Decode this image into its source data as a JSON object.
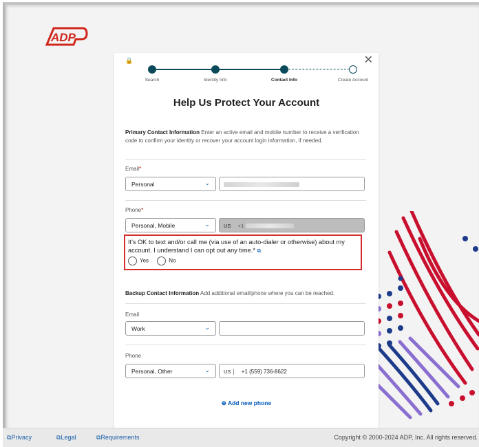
{
  "logo": {
    "text": "ADP"
  },
  "colors": {
    "brand": "#d0271d",
    "step": "#0a4a5a",
    "link": "#0057b8",
    "highlight": "#d52b2b"
  },
  "stepper": [
    {
      "label": "Search",
      "state": "done"
    },
    {
      "label": "Identity Info",
      "state": "done"
    },
    {
      "label": "Contact Info",
      "state": "current"
    },
    {
      "label": "Create Account",
      "state": "pending"
    }
  ],
  "title": "Help Us Protect Your Account",
  "primary": {
    "heading": "Primary Contact Information",
    "text": "Enter an active email and mobile number to receive a verification code to confirm your identity or recover your account login information, if needed.",
    "email_label": "Email",
    "email_type": "Personal",
    "phone_label": "Phone",
    "phone_type": "Personal, Mobile",
    "phone_country": "US",
    "phone_prefix": "+1"
  },
  "consent": {
    "text": "It's OK to text and/or call me (via use of an auto-dialer or otherwise) about my account. I understand I can opt out any time.",
    "required_mark": "*",
    "yes": "Yes",
    "no": "No"
  },
  "backup": {
    "heading": "Backup Contact Information",
    "text": "Add additional email/phone where you can be reached.",
    "email_label": "Email",
    "email_type": "Work",
    "phone_label": "Phone",
    "phone_type": "Personal, Other",
    "phone_country": "US",
    "phone_number": "+1 (559) 736-8622"
  },
  "add_phone": "Add new phone",
  "footer": {
    "privacy": "Privacy",
    "legal": "Legal",
    "requirements": "Requirements",
    "copyright": "Copyright © 2000-2024 ADP, Inc. All rights reserved."
  }
}
